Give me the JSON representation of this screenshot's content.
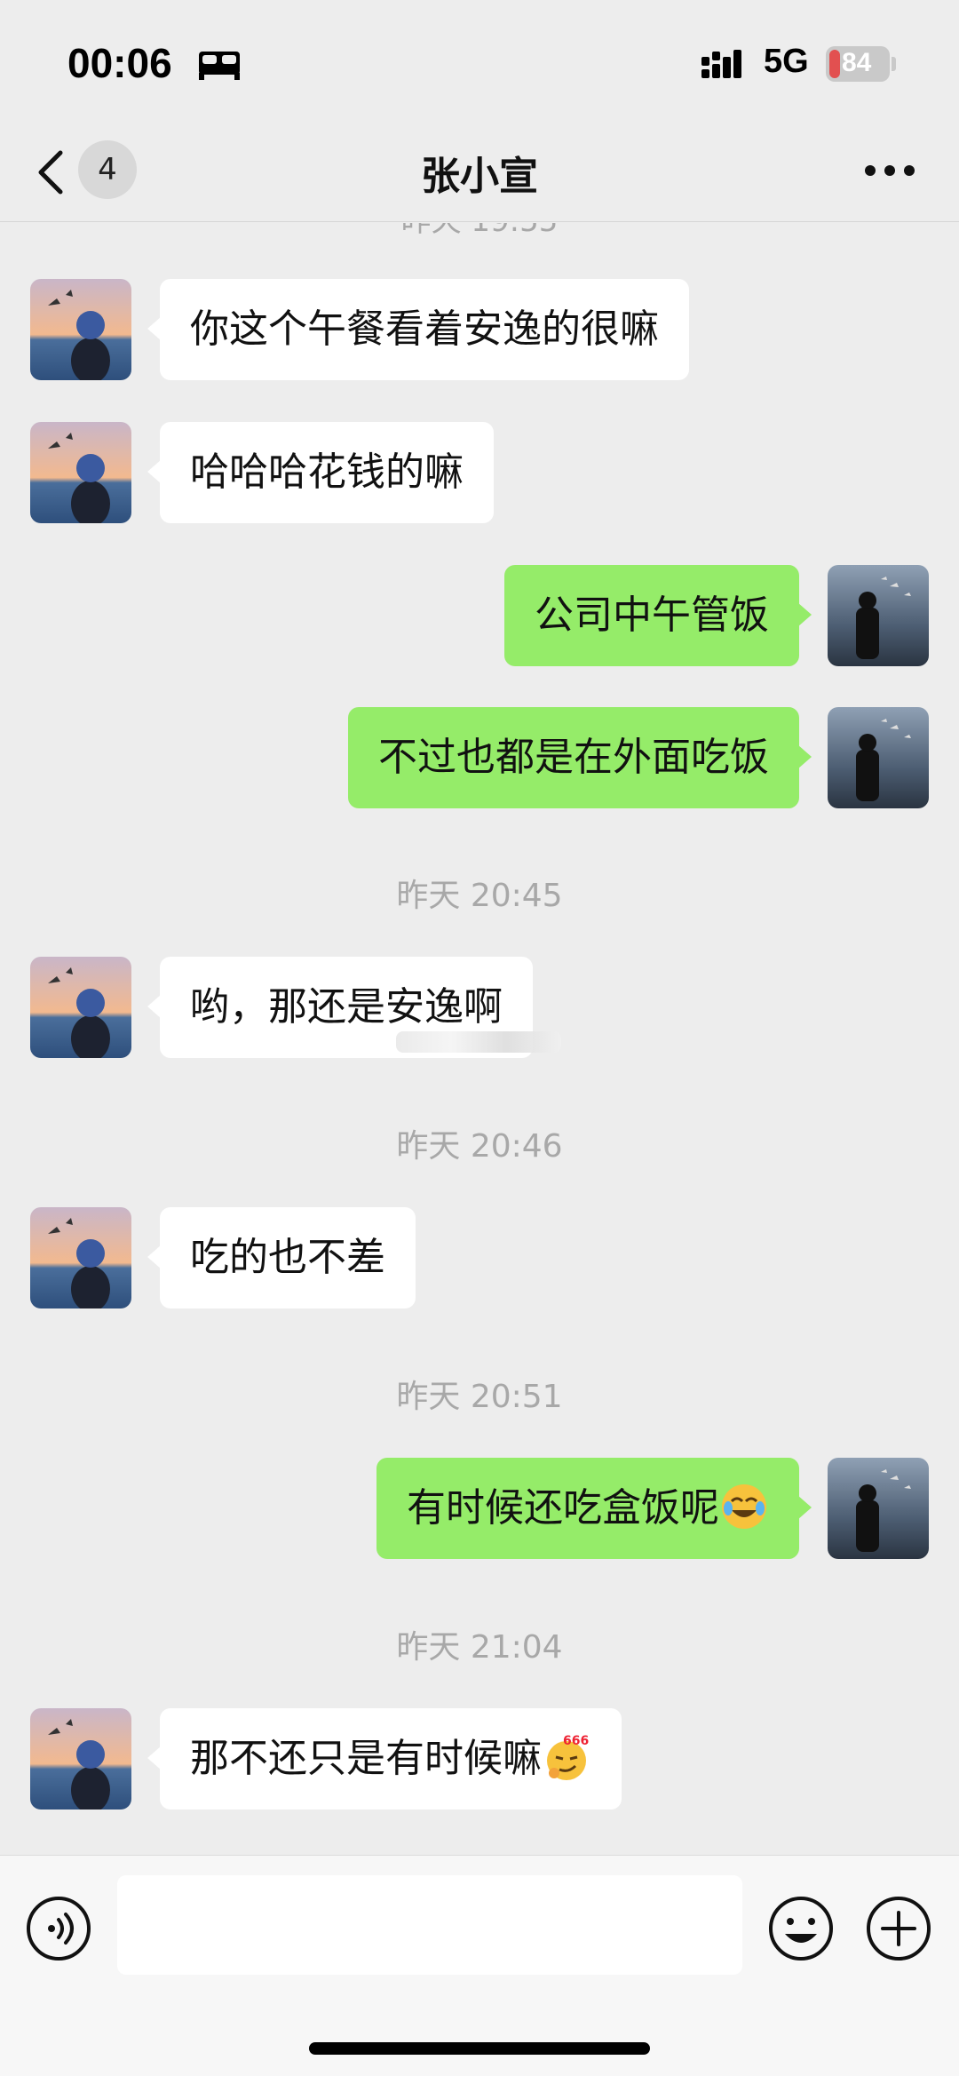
{
  "status_bar": {
    "time": "00:06",
    "network": "5G",
    "battery": "84",
    "icons": [
      "sleep-icon",
      "signal-icon",
      "battery-icon"
    ]
  },
  "nav": {
    "unread_count": "4",
    "title": "张小宣",
    "icons": [
      "back-icon",
      "more-icon"
    ]
  },
  "messages": [
    {
      "side": "left",
      "text": "你这个午餐看着安逸的很嘛"
    },
    {
      "side": "left",
      "text": "哈哈哈花钱的嘛"
    },
    {
      "side": "right",
      "text": "公司中午管饭"
    },
    {
      "side": "right",
      "text": "不过也都是在外面吃饭"
    },
    {
      "timestamp": "昨天 20:45"
    },
    {
      "side": "left",
      "text": "哟，那还是安逸啊"
    },
    {
      "timestamp": "昨天 20:46"
    },
    {
      "side": "left",
      "text": "吃的也不差"
    },
    {
      "timestamp": "昨天 20:51"
    },
    {
      "side": "right",
      "text": "有时候还吃盒饭呢",
      "emoji": "laughing-crying-emoji"
    },
    {
      "timestamp": "昨天 21:04"
    },
    {
      "side": "left",
      "text": "那不还只是有时候嘛",
      "emoji": "666-smirk-emoji"
    }
  ],
  "input_bar": {
    "value": "",
    "icons": [
      "voice-icon",
      "emoji-icon",
      "plus-icon"
    ]
  },
  "colors": {
    "background": "#ededed",
    "sent_bubble": "#95ec69",
    "received_bubble": "#ffffff",
    "timestamp": "#a8a8a8"
  }
}
